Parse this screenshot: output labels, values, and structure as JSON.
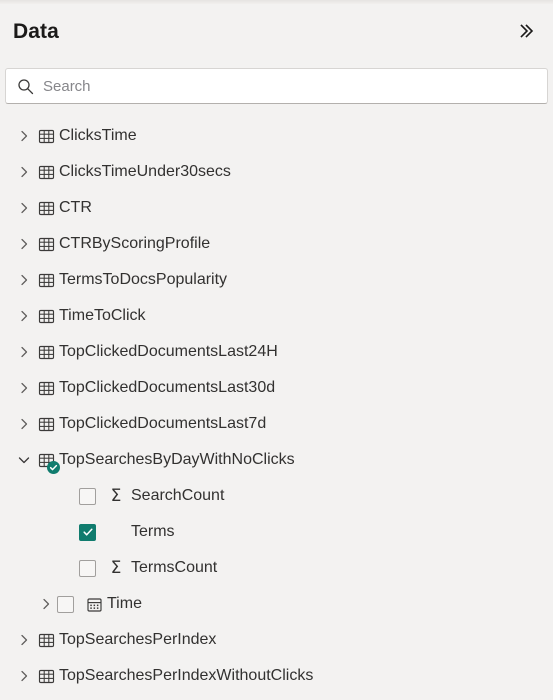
{
  "panel": {
    "title": "Data",
    "collapse_icon": "double-chevron-right-icon",
    "accent_color": "#107c6e",
    "background_color": "#f3f2f1"
  },
  "search": {
    "placeholder": "Search",
    "value": "",
    "icon": "search-icon"
  },
  "tree": {
    "items": [
      {
        "label": "ClicksTime",
        "type": "table",
        "icon": "table-icon",
        "expander": "chevron-right-icon",
        "expanded": false,
        "selected": false
      },
      {
        "label": "ClicksTimeUnder30secs",
        "type": "table",
        "icon": "table-icon",
        "expander": "chevron-right-icon",
        "expanded": false,
        "selected": false
      },
      {
        "label": "CTR",
        "type": "table",
        "icon": "table-icon",
        "expander": "chevron-right-icon",
        "expanded": false,
        "selected": false
      },
      {
        "label": "CTRByScoringProfile",
        "type": "table",
        "icon": "table-icon",
        "expander": "chevron-right-icon",
        "expanded": false,
        "selected": false
      },
      {
        "label": "TermsToDocsPopularity",
        "type": "table",
        "icon": "table-icon",
        "expander": "chevron-right-icon",
        "expanded": false,
        "selected": false
      },
      {
        "label": "TimeToClick",
        "type": "table",
        "icon": "table-icon",
        "expander": "chevron-right-icon",
        "expanded": false,
        "selected": false
      },
      {
        "label": "TopClickedDocumentsLast24H",
        "type": "table",
        "icon": "table-icon",
        "expander": "chevron-right-icon",
        "expanded": false,
        "selected": false
      },
      {
        "label": "TopClickedDocumentsLast30d",
        "type": "table",
        "icon": "table-icon",
        "expander": "chevron-right-icon",
        "expanded": false,
        "selected": false
      },
      {
        "label": "TopClickedDocumentsLast7d",
        "type": "table",
        "icon": "table-icon",
        "expander": "chevron-right-icon",
        "expanded": false,
        "selected": false
      },
      {
        "label": "TopSearchesByDayWithNoClicks",
        "type": "table",
        "icon": "table-icon",
        "expander": "chevron-down-icon",
        "expanded": true,
        "selected": true,
        "badge": "check-circle-badge"
      },
      {
        "label": "SearchCount",
        "type": "field-measure",
        "icon": "sigma-icon",
        "checkbox": "unchecked",
        "expander": "none"
      },
      {
        "label": "Terms",
        "type": "field-text",
        "icon": "none",
        "checkbox": "checked",
        "expander": "none"
      },
      {
        "label": "TermsCount",
        "type": "field-measure",
        "icon": "sigma-icon",
        "checkbox": "unchecked",
        "expander": "none"
      },
      {
        "label": "Time",
        "type": "field-date",
        "icon": "calendar-icon",
        "checkbox": "unchecked",
        "expander": "chevron-right-icon"
      },
      {
        "label": "TopSearchesPerIndex",
        "type": "table",
        "icon": "table-icon",
        "expander": "chevron-right-icon",
        "expanded": false,
        "selected": false
      },
      {
        "label": "TopSearchesPerIndexWithoutClicks",
        "type": "table",
        "icon": "table-icon",
        "expander": "chevron-right-icon",
        "expanded": false,
        "selected": false
      }
    ]
  }
}
